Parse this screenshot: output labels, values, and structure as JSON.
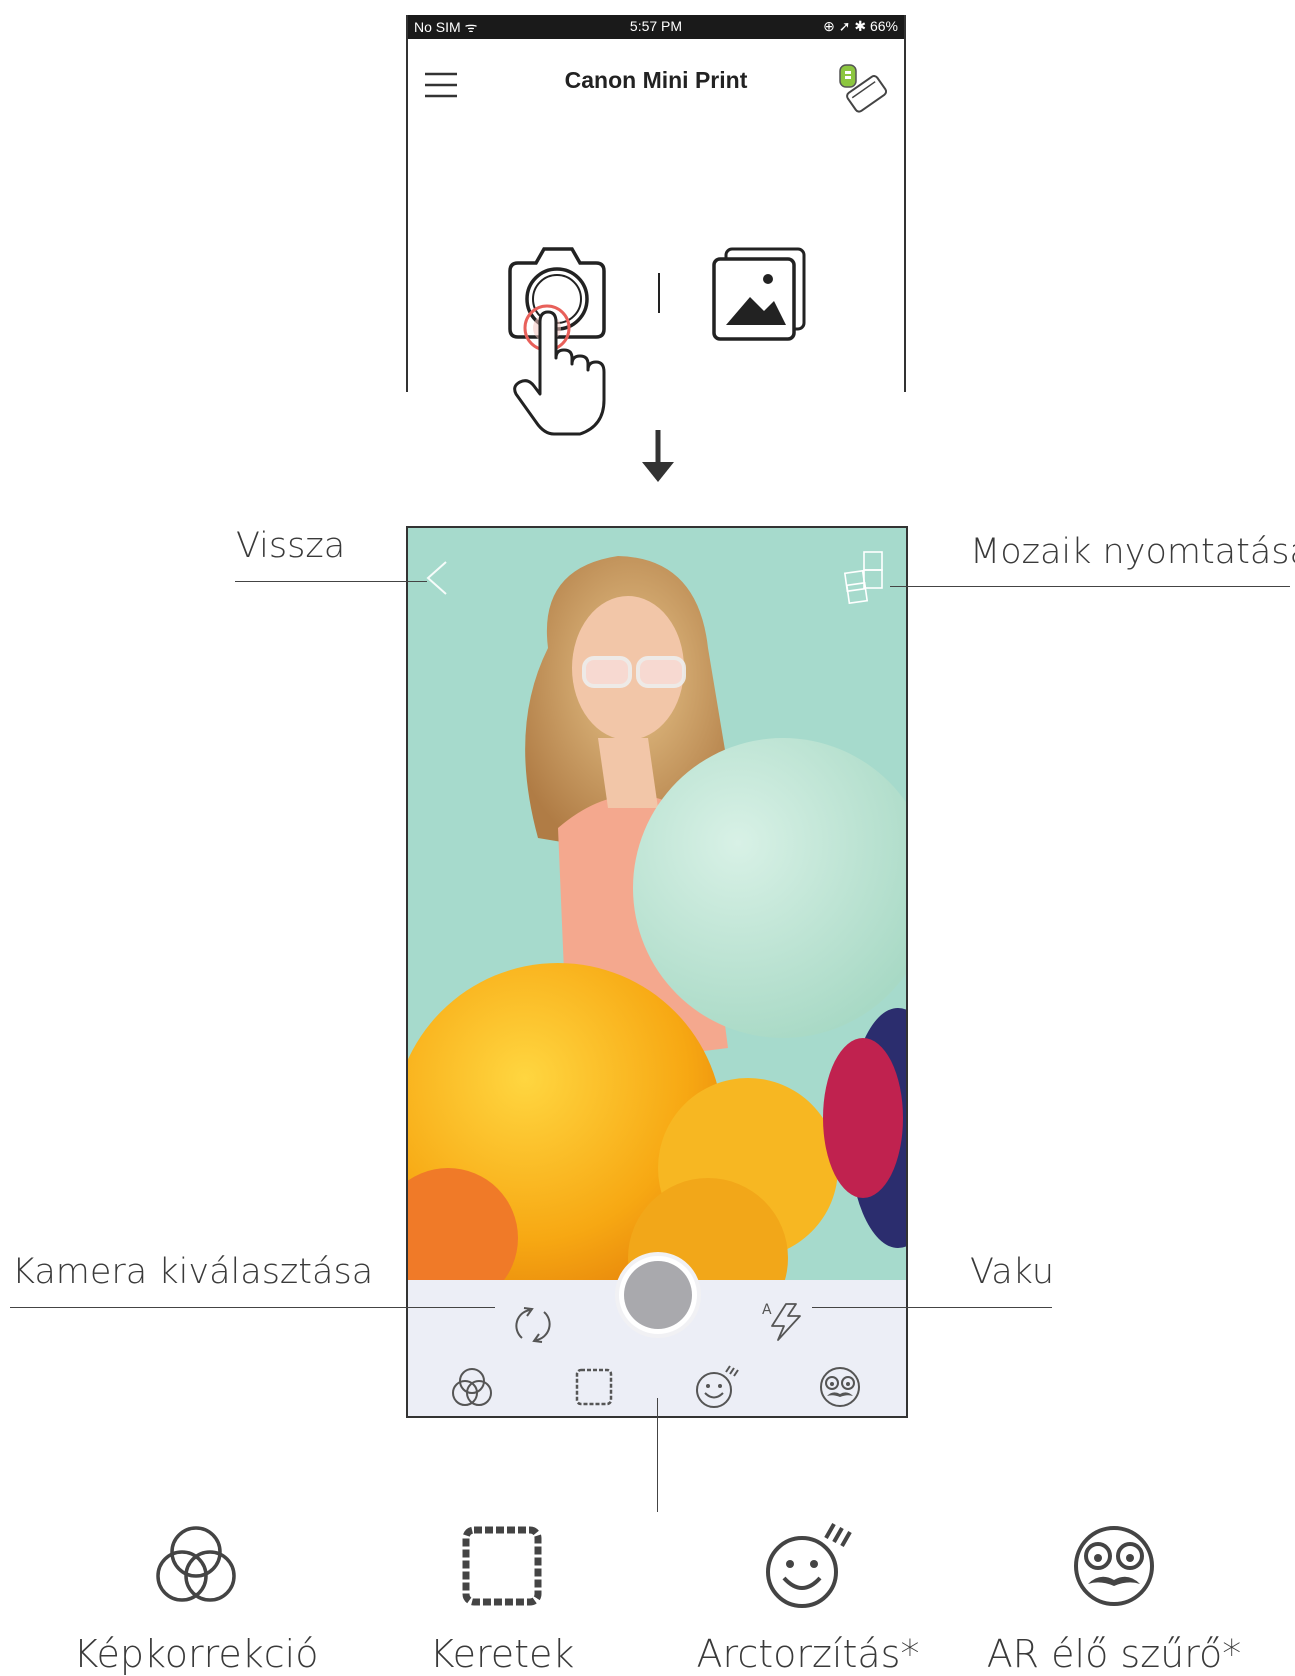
{
  "status_bar": {
    "carrier": "No SIM ᯤ",
    "time": "5:57 PM",
    "right": "⊕ ➚ ✱ 66%"
  },
  "app": {
    "title": "Canon Mini Print"
  },
  "callouts": {
    "back": "Vissza",
    "mosaic": "Mozaik nyomtatása",
    "camera_select": "Kamera kiválasztása",
    "flash": "Vaku"
  },
  "flash_label": "A",
  "legend": [
    {
      "icon": "color-correction-icon",
      "label": "Képkorrekció"
    },
    {
      "icon": "frames-icon",
      "label": "Keretek"
    },
    {
      "icon": "face-distort-icon",
      "label": "Arctorzítás*"
    },
    {
      "icon": "ar-filter-icon",
      "label": "AR élő szűrő*"
    }
  ],
  "colors": {
    "accent_ring": "#e8605a",
    "background_photo": "#a6dacc",
    "controls_bar": "#eceef6"
  }
}
